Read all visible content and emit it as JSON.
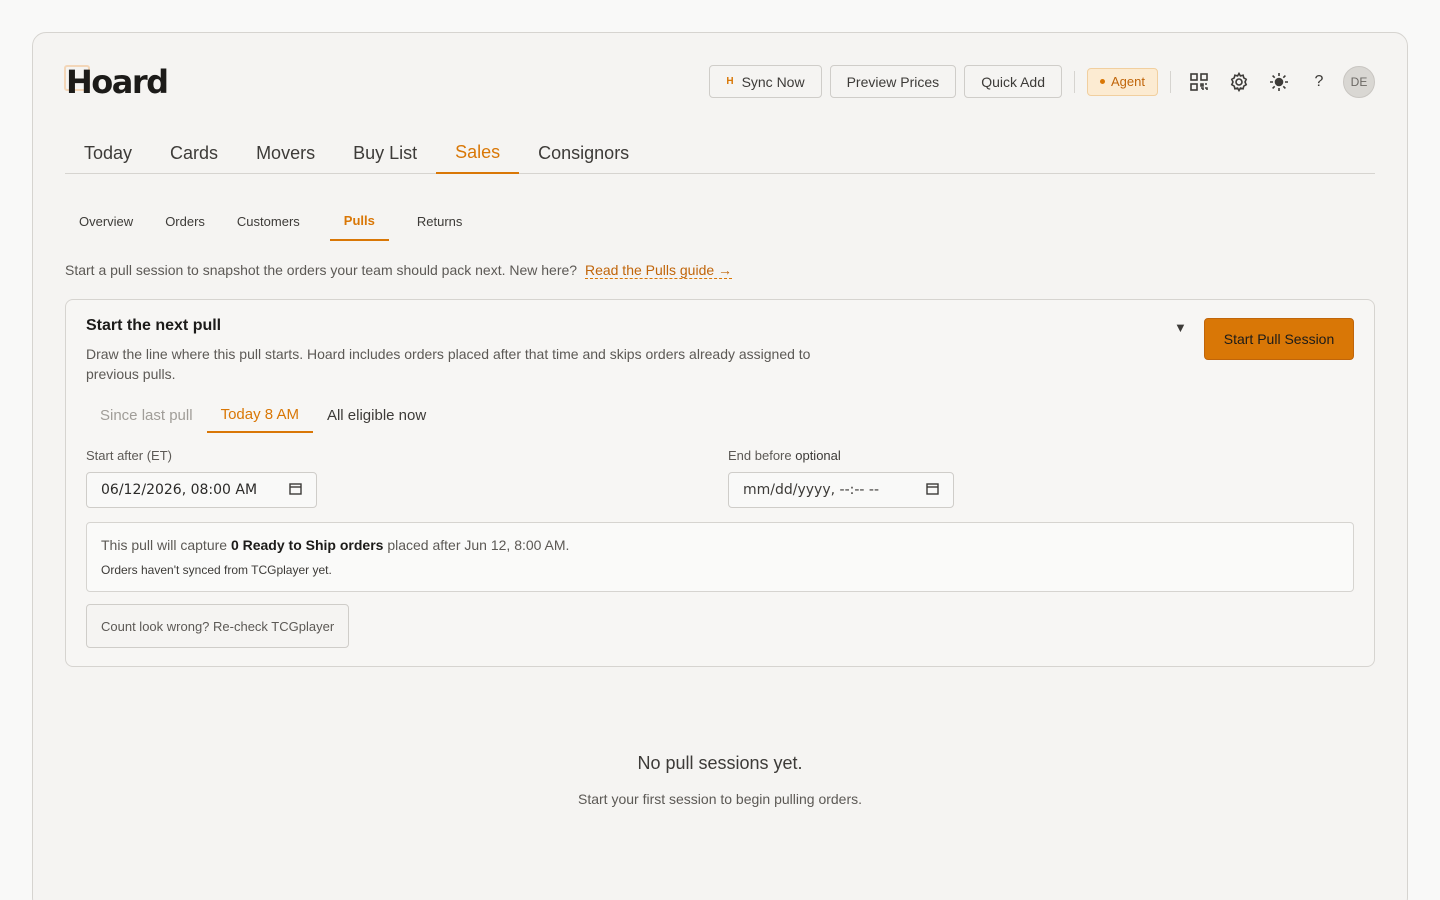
{
  "app": {
    "logo": "Hoard"
  },
  "header": {
    "sync_now": "Sync Now",
    "sync_glyph": "H",
    "preview_prices": "Preview Prices",
    "quick_add": "Quick Add",
    "agent": "Agent",
    "help": "?",
    "avatar_initials": "DE",
    "icons": [
      "qr-code-icon",
      "gear-icon",
      "sun-icon",
      "help-icon"
    ]
  },
  "main_tabs": [
    {
      "label": "Today"
    },
    {
      "label": "Cards"
    },
    {
      "label": "Movers"
    },
    {
      "label": "Buy List"
    },
    {
      "label": "Sales",
      "active": true
    },
    {
      "label": "Consignors"
    }
  ],
  "sub_tabs": [
    {
      "label": "Overview"
    },
    {
      "label": "Orders"
    },
    {
      "label": "Customers"
    },
    {
      "label": "Pulls",
      "active": true
    },
    {
      "label": "Returns"
    }
  ],
  "intro": {
    "text": "Start a pull session to snapshot the orders your team should pack next. New here?",
    "link": "Read the Pulls guide →"
  },
  "pull_card": {
    "title": "Start the next pull",
    "description": "Draw the line where this pull starts. Hoard includes orders placed after that time and skips orders already assigned to previous pulls.",
    "collapse_glyph": "▼",
    "start_button": "Start Pull Session",
    "range_tabs": [
      {
        "label": "Since last pull",
        "state": "muted"
      },
      {
        "label": "Today 8 AM",
        "state": "active"
      },
      {
        "label": "All eligible now",
        "state": "normal"
      }
    ],
    "start_after_label": "Start after (ET)",
    "start_after_value": "06/12/2026, 08:00 AM",
    "end_before_label": "End before",
    "end_before_optional": "optional",
    "end_before_placeholder": "mm/dd/yyyy, --:-- --",
    "summary": {
      "prefix": "This pull will capture",
      "bold": "0 Ready to Ship orders",
      "suffix": "placed after Jun 12, 8:00 AM.",
      "note": "Orders haven't synced from TCGplayer yet."
    },
    "recheck_button": "Count look wrong? Re-check TCGplayer"
  },
  "empty_state": {
    "title": "No pull sessions yet.",
    "subtitle": "Start your first session to begin pulling orders."
  },
  "colors": {
    "accent": "#d97706",
    "text": "#2b2a28",
    "border": "#d6d4d0"
  }
}
